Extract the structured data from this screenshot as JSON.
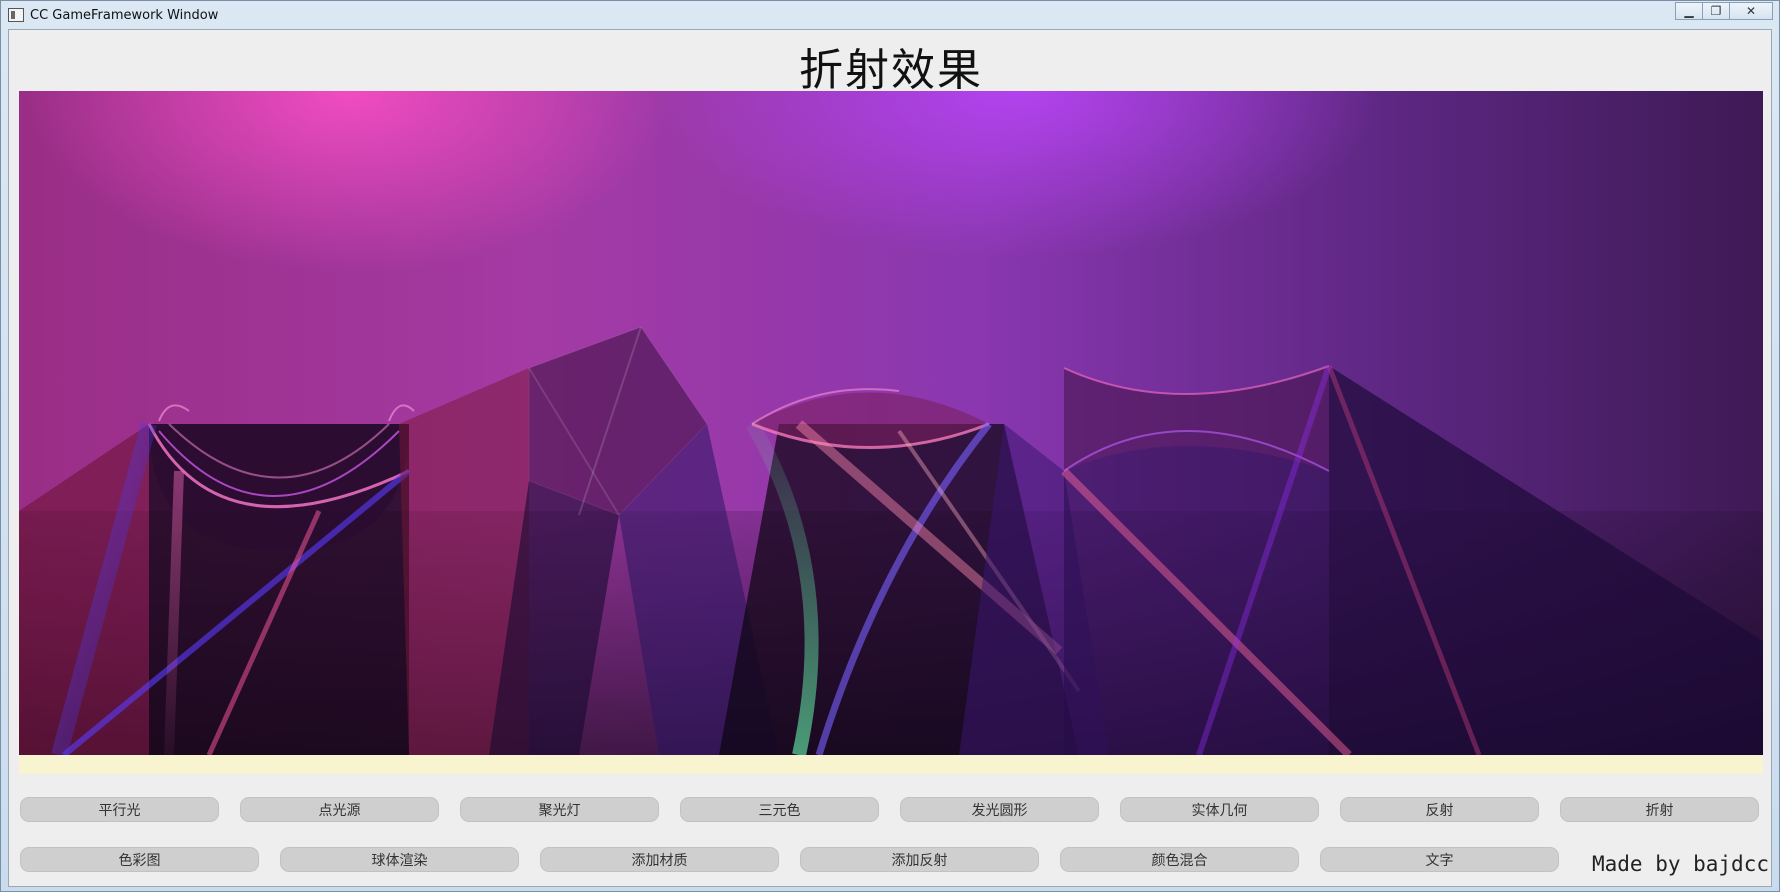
{
  "window": {
    "title": "CC GameFramework Window",
    "controls": [
      "minimize-icon",
      "restore-icon",
      "close-icon"
    ]
  },
  "main": {
    "heading": "折射效果"
  },
  "buttons_row1": [
    "平行光",
    "点光源",
    "聚光灯",
    "三元色",
    "发光圆形",
    "实体几何",
    "反射",
    "折射"
  ],
  "buttons_row2": [
    "色彩图",
    "球体渲染",
    "添加材质",
    "添加反射",
    "颜色混合",
    "文字"
  ],
  "credit": "Made by bajdcc",
  "colors": {
    "background_magenta": "#a43aa4",
    "background_purple": "#5b2680",
    "status_strip": "#f7f4cf",
    "button_face": "#cfcfcf"
  }
}
